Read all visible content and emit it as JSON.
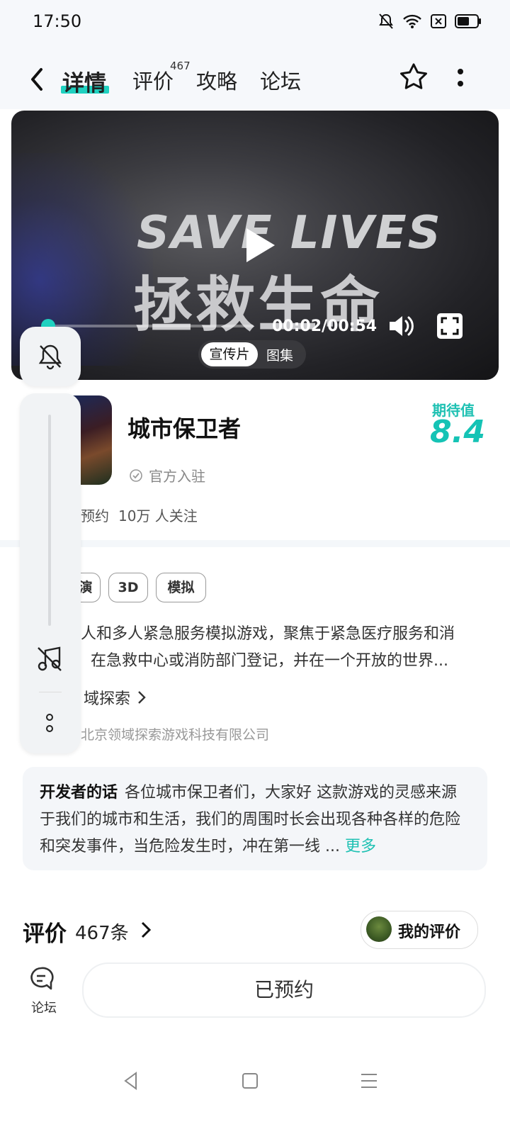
{
  "status_bar": {
    "time": "17:50"
  },
  "nav": {
    "tabs": [
      {
        "label": "详情",
        "active": true
      },
      {
        "label": "评价",
        "badge": "467"
      },
      {
        "label": "攻略"
      },
      {
        "label": "论坛"
      }
    ]
  },
  "video": {
    "title_en": "SAVE LIVES",
    "title_cn": "拯救生命",
    "time": "00:02/00:54",
    "progress": 0.037,
    "segments": [
      "宣传片",
      "图集"
    ]
  },
  "game": {
    "title": "城市保卫者",
    "official": "官方入驻",
    "expectation_label": "期待值",
    "expectation_score": "8.4",
    "reserved_text": "预约",
    "follow_text": "10万 人关注"
  },
  "tags": [
    "演",
    "3D",
    "模拟"
  ],
  "description": {
    "line1": "人和多人紧急服务模拟游戏，聚焦于紧急医疗服务和消",
    "line2": "在急救中心或消防部门登记，并在一个开放的世界...",
    "developer_link": "域探索",
    "company": "北京领域探索游戏科技有限公司"
  },
  "developer_notes": {
    "title": "开发者的话",
    "text": "各位城市保卫者们，大家好 这款游戏的灵感来源于我们的城市和生活，我们的周围时长会出现各种各样的危险和突发事件，当危险发生时，冲在第一线 ...",
    "more": "更多"
  },
  "reviews": {
    "title": "评价",
    "count": "467条",
    "my_review": "我的评价"
  },
  "bottom": {
    "forum_label": "论坛",
    "reserved_button": "已预约"
  },
  "colors": {
    "accent": "#1fd1c0",
    "score": "#15c3b5"
  },
  "icons": [
    "back-arrow-icon",
    "star-icon",
    "more-vertical-icon",
    "play-icon",
    "volume-icon",
    "fullscreen-icon",
    "bell-off-icon",
    "music-off-icon",
    "more-dots-icon",
    "verified-icon",
    "chevron-right-icon",
    "forum-icon",
    "nav-back-icon",
    "nav-home-icon",
    "nav-menu-icon"
  ]
}
